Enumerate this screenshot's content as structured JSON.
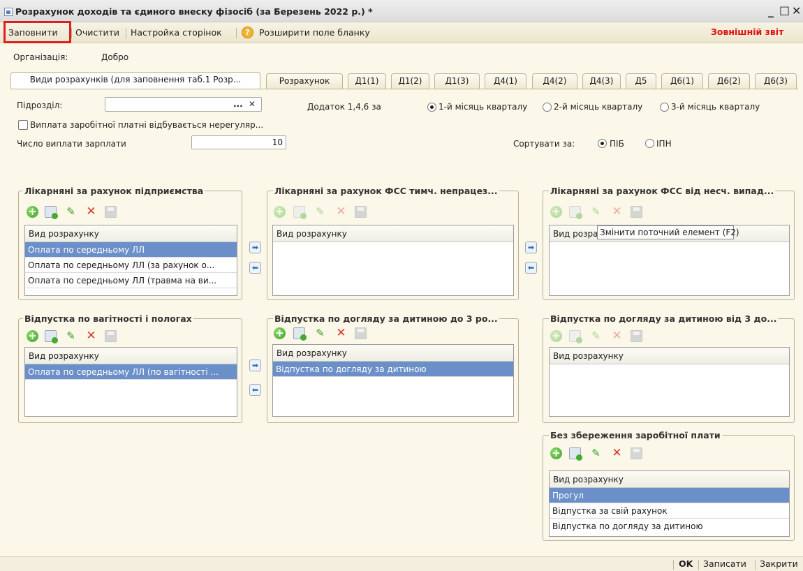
{
  "window": {
    "title": "Розрахунок доходів та єдиного внеску фізосіб (за Березень 2022 р.) *",
    "minimize": "_",
    "maximize": "□",
    "close": "✕"
  },
  "toolbar": {
    "fill": "Заповнити",
    "clear": "Очистити",
    "page_setup": "Настройка сторінок",
    "expand": "Розширити поле бланку",
    "help_icon": "?",
    "external_report": "Зовнішній звіт"
  },
  "org": {
    "label": "Організація:",
    "value": "Добро"
  },
  "tabs": [
    "Види розрахунків (для заповнення таб.1 Розр...",
    "Розрахунок",
    "Д1(1)",
    "Д1(2)",
    "Д1(3)",
    "Д4(1)",
    "Д4(2)",
    "Д4(3)",
    "Д5",
    "Д6(1)",
    "Д6(2)",
    "Д6(3)"
  ],
  "form": {
    "subdivision_label": "Підрозділ:",
    "subdivision_value": "",
    "select_btn": "...",
    "clear_btn": "✕",
    "addendum_label": "Додаток 1,4,6 за",
    "months": [
      {
        "label": "1-й місяць кварталу",
        "selected": true
      },
      {
        "label": "2-й місяць кварталу",
        "selected": false
      },
      {
        "label": "3-й місяць кварталу",
        "selected": false
      }
    ],
    "irregular_label": "Виплата заробітної платні відбувається нерегуляр...",
    "irregular_checked": false,
    "payout_count_label": "Число виплати зарплати",
    "payout_count_value": "10",
    "sort_label": "Сортувати за:",
    "sort_options": [
      {
        "label": "ПІБ",
        "selected": true
      },
      {
        "label": "ІПН",
        "selected": false
      }
    ]
  },
  "column_header": "Вид розрахунку",
  "groups": [
    {
      "title": "Лікарняні за рахунок підприємства",
      "rows": [
        "Оплата по середньому ЛЛ",
        "Оплата по середньому ЛЛ (за рахунок о...",
        "Оплата по середньому ЛЛ (травма на ви..."
      ],
      "selected": 0
    },
    {
      "title": "Лікарняні за рахунок ФСС тимч. непрацез...",
      "rows": [],
      "selected": -1
    },
    {
      "title": "Лікарняні за рахунок ФСС від несч. випад...",
      "rows": [],
      "selected": -1
    },
    {
      "title": "Відпустка  по вагітності і пологах",
      "rows": [
        "Оплата по середньому ЛЛ (по вагітності ..."
      ],
      "selected": 0
    },
    {
      "title": "Відпустка по догляду за дитиною до 3 ро...",
      "rows": [
        "Відпустка по догляду за дитиною"
      ],
      "selected": 0
    },
    {
      "title": "Відпустка по догляду за дитиною від 3 до...",
      "rows": [],
      "selected": -1
    },
    {
      "title": "Без збереження заробітної плати",
      "rows": [
        "Прогул",
        "Відпустка за свій рахунок",
        "Відпустка по догляду за дитиною"
      ],
      "selected": 0
    }
  ],
  "tooltip": "Змінити поточний елемент (F2)",
  "arrows": {
    "right": "➡",
    "left": "⬅"
  },
  "icons": {
    "add": "+",
    "edit": "✎",
    "delete": "✕"
  },
  "footer": {
    "ok": "OK",
    "save": "Записати",
    "close": "Закрити"
  }
}
